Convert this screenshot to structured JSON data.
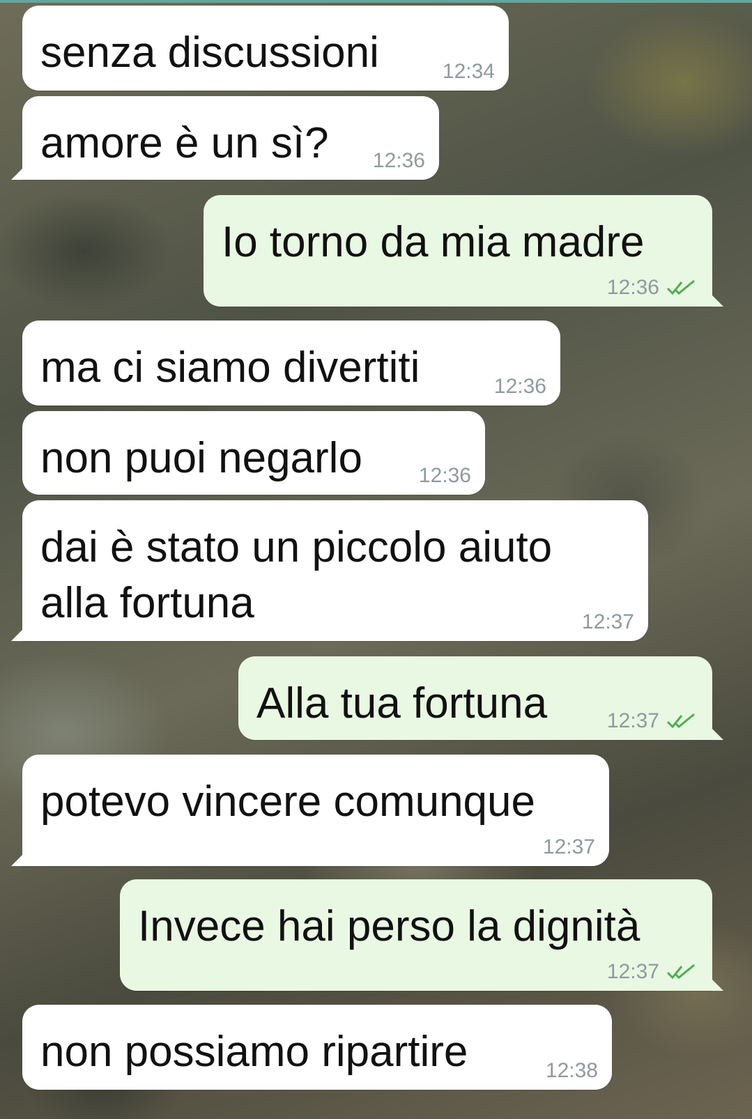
{
  "messages": [
    {
      "direction": "in",
      "text": "senza discussioni",
      "time": "12:34"
    },
    {
      "direction": "in",
      "text": "amore è un sì?",
      "time": "12:36"
    },
    {
      "direction": "out",
      "text": "Io torno da mia madre",
      "time": "12:36",
      "status": "read"
    },
    {
      "direction": "in",
      "text": "ma ci siamo divertiti",
      "time": "12:36"
    },
    {
      "direction": "in",
      "text": "non puoi negarlo",
      "time": "12:36"
    },
    {
      "direction": "in",
      "text": "dai è stato un piccolo aiuto\nalla fortuna",
      "time": "12:37"
    },
    {
      "direction": "out",
      "text": "Alla tua fortuna",
      "time": "12:37",
      "status": "read"
    },
    {
      "direction": "in",
      "text": "potevo vincere comunque",
      "time": "12:37"
    },
    {
      "direction": "out",
      "text": "Invece hai perso la dignità",
      "time": "12:37",
      "status": "read"
    },
    {
      "direction": "in",
      "text": "non possiamo ripartire",
      "time": "12:38"
    }
  ],
  "colors": {
    "incoming_bubble": "#ffffff",
    "outgoing_bubble": "#e9f8e2",
    "timestamp": "#8e9a9f",
    "read_ticks": "#4caf50"
  },
  "icons": {
    "read_receipt": "double-check-icon"
  }
}
